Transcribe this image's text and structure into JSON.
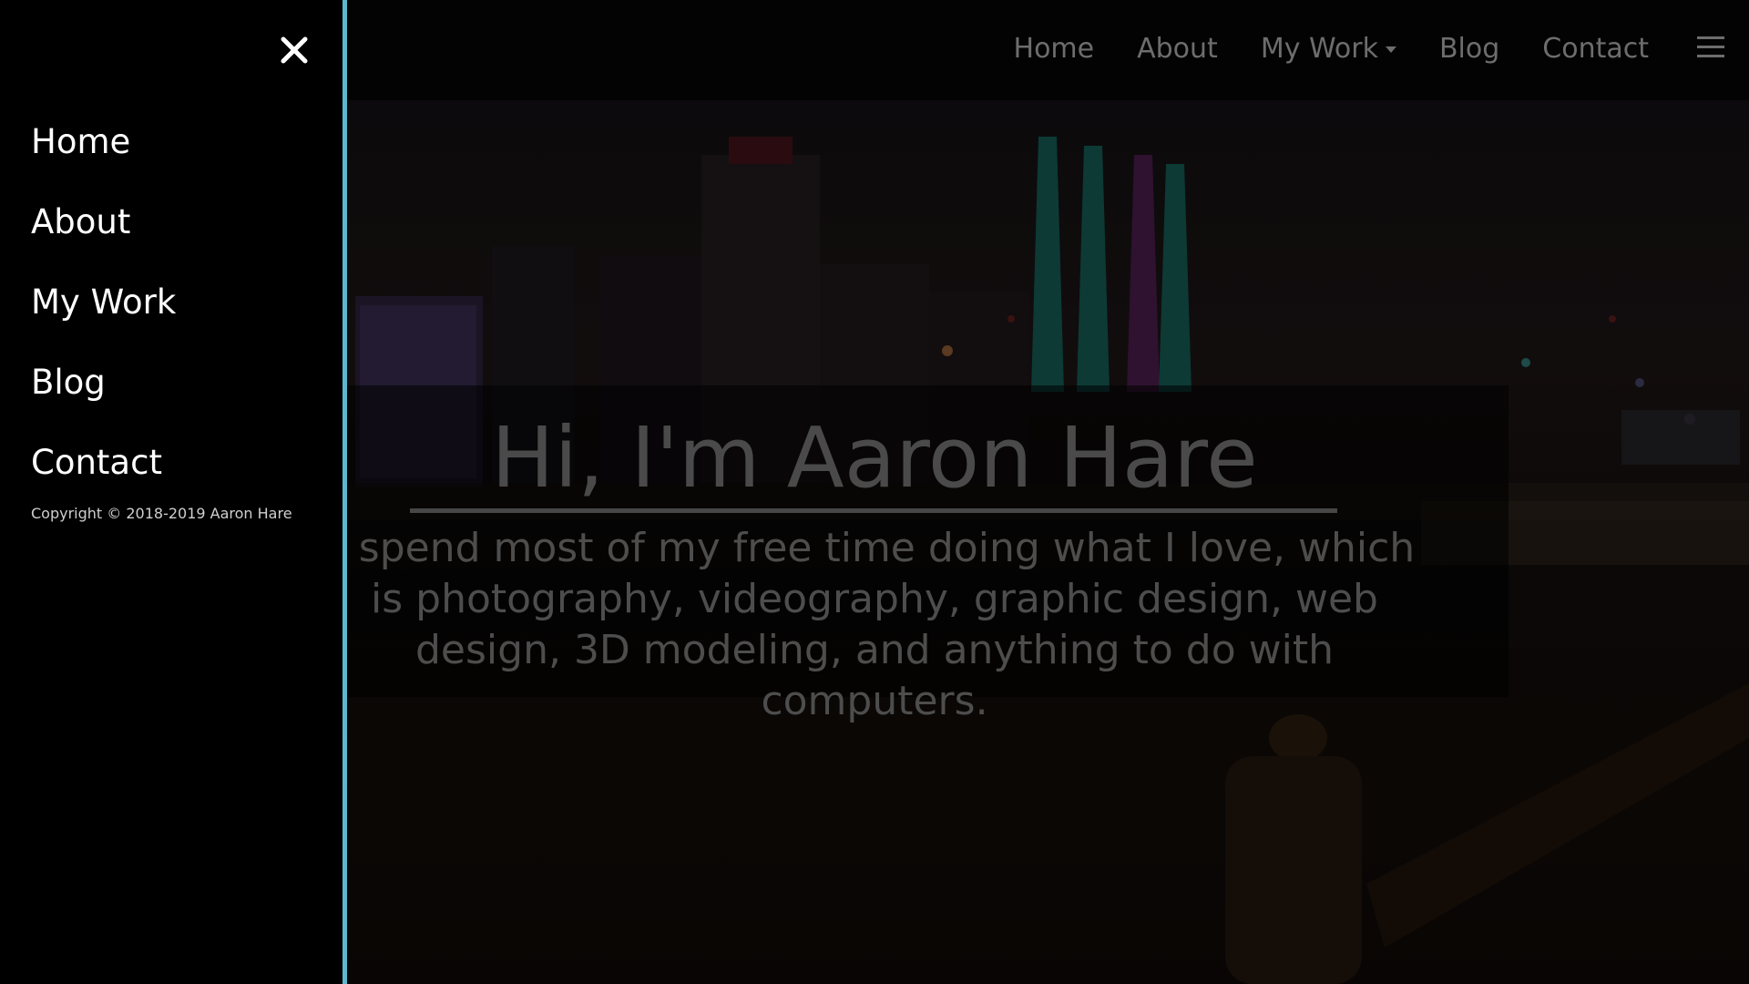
{
  "topnav": {
    "items": [
      {
        "label": "Home"
      },
      {
        "label": "About"
      },
      {
        "label": "My Work"
      },
      {
        "label": "Blog"
      },
      {
        "label": "Contact"
      }
    ],
    "menu_icon": "hamburger-icon"
  },
  "hero": {
    "title": "Hi, I'm Aaron Hare",
    "text": "I spend most of my free time doing what I love, which is photography, videography, graphic design, web design, 3D modeling, and anything to do with computers."
  },
  "drawer": {
    "close_icon": "close-icon",
    "items": [
      {
        "label": "Home"
      },
      {
        "label": "About"
      },
      {
        "label": "My Work"
      },
      {
        "label": "Blog"
      },
      {
        "label": "Contact"
      }
    ],
    "copyright": "Copyright © 2018-2019 Aaron Hare"
  },
  "colors": {
    "drawer_border": "#5bb8d0",
    "drawer_background": "#000000",
    "nav_text": "#6d6d6d"
  }
}
